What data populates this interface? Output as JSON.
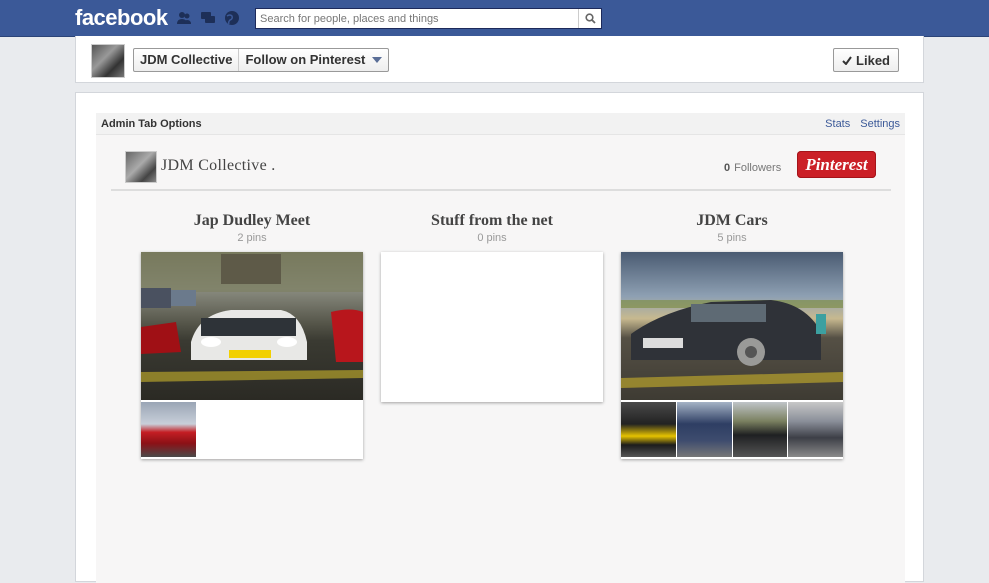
{
  "topbar": {
    "logo": "facebook",
    "search_placeholder": "Search for people, places and things",
    "icons": [
      "friend-requests-icon",
      "messages-icon",
      "notifications-icon",
      "search-icon"
    ]
  },
  "page_header": {
    "page_name": "JDM Collective",
    "tab_name": "Follow on Pinterest",
    "liked_label": "Liked"
  },
  "admin_bar": {
    "title": "Admin Tab Options",
    "links": [
      "Stats",
      "Settings"
    ]
  },
  "profile": {
    "name": "JDM Collective .",
    "followers_count": "0",
    "followers_label": "Followers",
    "pinterest_label": "Pinterest"
  },
  "boards": [
    {
      "title": "Jap Dudley Meet",
      "pins": "2 pins"
    },
    {
      "title": "Stuff from the net",
      "pins": "0 pins"
    },
    {
      "title": "JDM Cars",
      "pins": "5 pins"
    }
  ],
  "colors": {
    "brand": "#3b5998",
    "pinterest": "#cb2027"
  }
}
